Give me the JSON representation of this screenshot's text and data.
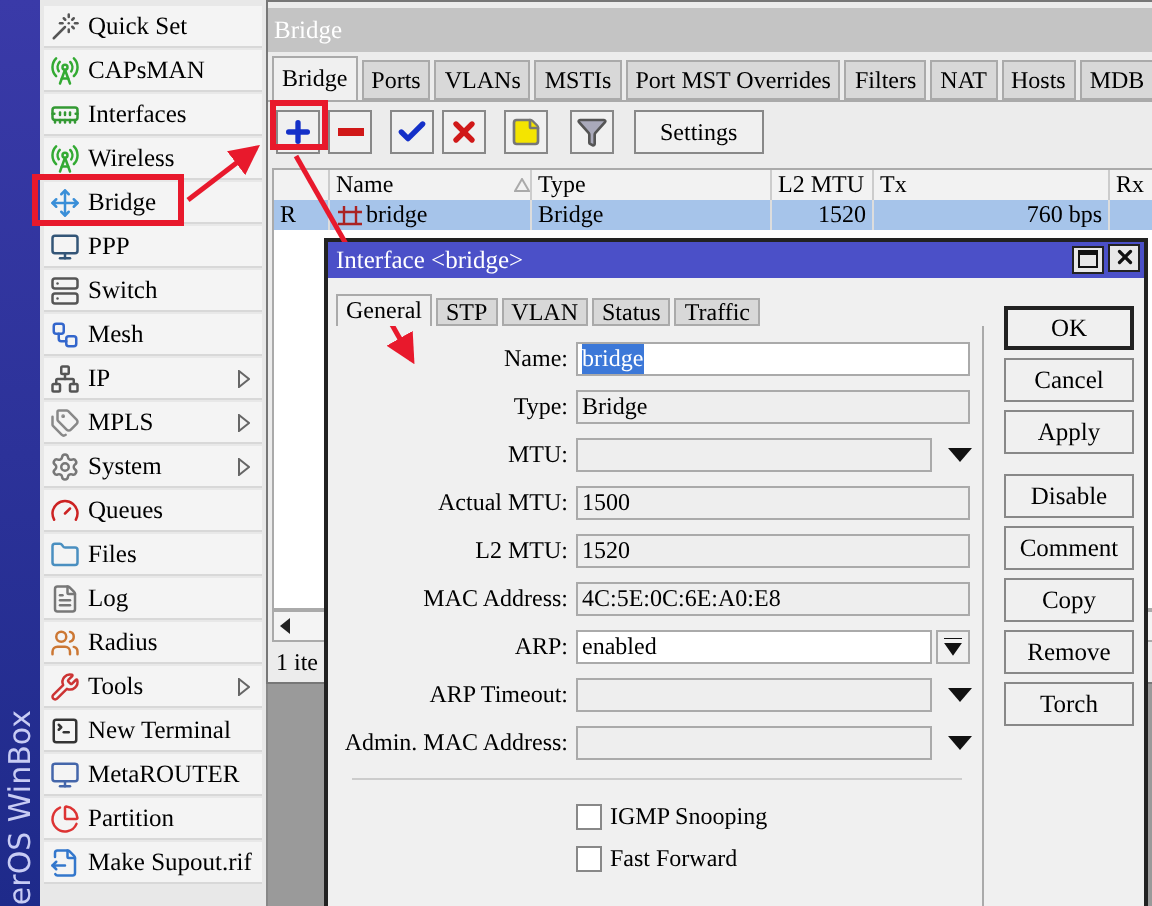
{
  "brand": "erOS WinBox",
  "sidebar": {
    "items": [
      {
        "label": "Quick Set",
        "submenu": false
      },
      {
        "label": "CAPsMAN",
        "submenu": false
      },
      {
        "label": "Interfaces",
        "submenu": false
      },
      {
        "label": "Wireless",
        "submenu": false
      },
      {
        "label": "Bridge",
        "submenu": false
      },
      {
        "label": "PPP",
        "submenu": false
      },
      {
        "label": "Switch",
        "submenu": false
      },
      {
        "label": "Mesh",
        "submenu": false
      },
      {
        "label": "IP",
        "submenu": true
      },
      {
        "label": "MPLS",
        "submenu": true
      },
      {
        "label": "System",
        "submenu": true
      },
      {
        "label": "Queues",
        "submenu": false
      },
      {
        "label": "Files",
        "submenu": false
      },
      {
        "label": "Log",
        "submenu": false
      },
      {
        "label": "Radius",
        "submenu": false
      },
      {
        "label": "Tools",
        "submenu": true
      },
      {
        "label": "New Terminal",
        "submenu": false
      },
      {
        "label": "MetaROUTER",
        "submenu": false
      },
      {
        "label": "Partition",
        "submenu": false
      },
      {
        "label": "Make Supout.rif",
        "submenu": false
      }
    ]
  },
  "bridge_window": {
    "title": "Bridge",
    "tabs": [
      {
        "label": "Bridge",
        "selected": true
      },
      {
        "label": "Ports",
        "selected": false
      },
      {
        "label": "VLANs",
        "selected": false
      },
      {
        "label": "MSTIs",
        "selected": false
      },
      {
        "label": "Port MST Overrides",
        "selected": false
      },
      {
        "label": "Filters",
        "selected": false
      },
      {
        "label": "NAT",
        "selected": false
      },
      {
        "label": "Hosts",
        "selected": false
      },
      {
        "label": "MDB",
        "selected": false
      }
    ],
    "settings_button": "Settings",
    "table": {
      "columns": [
        "Name",
        "Type",
        "L2 MTU",
        "Tx",
        "Rx"
      ],
      "rows": [
        {
          "flag": "R",
          "name": "bridge",
          "type": "Bridge",
          "l2_mtu": "1520",
          "tx": "760 bps",
          "selected": true
        }
      ]
    },
    "status": "1 ite"
  },
  "dialog": {
    "title": "Interface <bridge>",
    "tabs": [
      {
        "label": "General",
        "selected": true
      },
      {
        "label": "STP",
        "selected": false
      },
      {
        "label": "VLAN",
        "selected": false
      },
      {
        "label": "Status",
        "selected": false
      },
      {
        "label": "Traffic",
        "selected": false
      }
    ],
    "fields": [
      {
        "label": "Name:",
        "kind": "text",
        "value": "bridge",
        "value_selected": true
      },
      {
        "label": "Type:",
        "kind": "readonly",
        "value": "Bridge"
      },
      {
        "label": "MTU:",
        "kind": "dropdown"
      },
      {
        "label": "Actual MTU:",
        "kind": "readonly",
        "value": "1500"
      },
      {
        "label": "L2 MTU:",
        "kind": "readonly",
        "value": "1520"
      },
      {
        "label": "MAC Address:",
        "kind": "readonly",
        "value": "4C:5E:0C:6E:A0:E8"
      },
      {
        "label": "ARP:",
        "kind": "combo",
        "value": "enabled"
      },
      {
        "label": "ARP Timeout:",
        "kind": "dropdown"
      },
      {
        "label": "Admin. MAC Address:",
        "kind": "dropdown"
      }
    ],
    "checkboxes": [
      {
        "label": "IGMP Snooping",
        "checked": false
      },
      {
        "label": "Fast Forward",
        "checked": false
      }
    ],
    "buttons": [
      "OK",
      "Cancel",
      "Apply",
      "Disable",
      "Comment",
      "Copy",
      "Remove",
      "Torch"
    ]
  }
}
